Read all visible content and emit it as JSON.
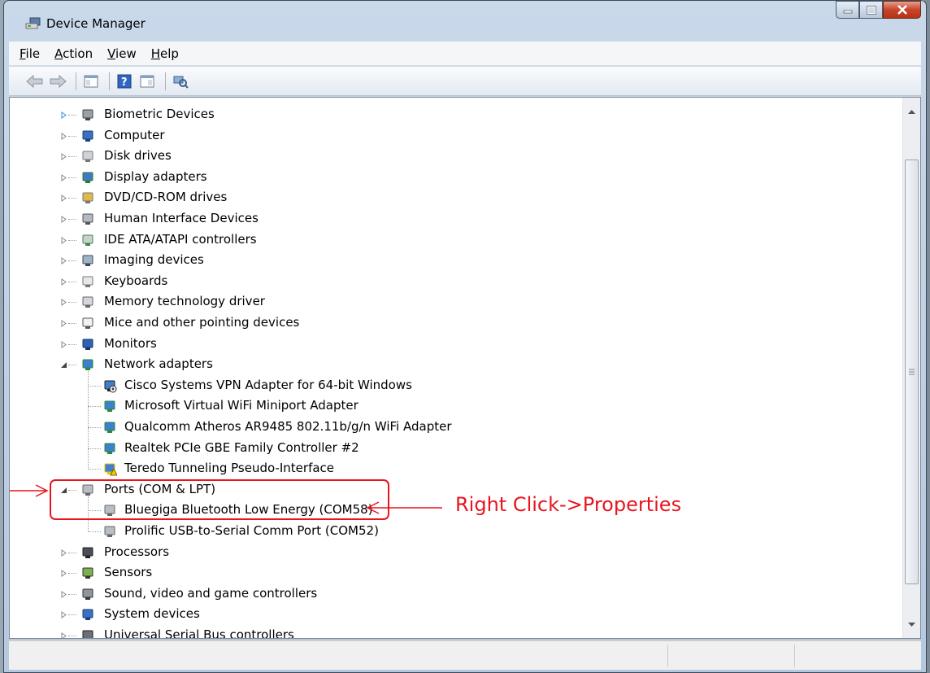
{
  "window": {
    "title": "Device Manager"
  },
  "menu": [
    {
      "label_pre": "",
      "label_ul": "F",
      "label_post": "ile"
    },
    {
      "label_pre": "",
      "label_ul": "A",
      "label_post": "ction"
    },
    {
      "label_pre": "",
      "label_ul": "V",
      "label_post": "iew"
    },
    {
      "label_pre": "",
      "label_ul": "H",
      "label_post": "elp"
    }
  ],
  "toolbar": [
    {
      "icon": "back-arrow-icon"
    },
    {
      "icon": "forward-arrow-icon"
    },
    {
      "icon": "show-hide-tree-icon"
    },
    {
      "icon": "help-icon"
    },
    {
      "icon": "properties-icon"
    },
    {
      "icon": "scan-hardware-icon"
    }
  ],
  "tree": [
    {
      "label": "Biometric Devices",
      "icon": "fingerprint-icon",
      "expanded": false,
      "level": 1
    },
    {
      "label": "Computer",
      "icon": "computer-icon",
      "expanded": false,
      "level": 1
    },
    {
      "label": "Disk drives",
      "icon": "disk-drive-icon",
      "expanded": false,
      "level": 1
    },
    {
      "label": "Display adapters",
      "icon": "display-adapter-icon",
      "expanded": false,
      "level": 1
    },
    {
      "label": "DVD/CD-ROM drives",
      "icon": "dvd-drive-icon",
      "expanded": false,
      "level": 1
    },
    {
      "label": "Human Interface Devices",
      "icon": "hid-icon",
      "expanded": false,
      "level": 1
    },
    {
      "label": "IDE ATA/ATAPI controllers",
      "icon": "ide-controller-icon",
      "expanded": false,
      "level": 1
    },
    {
      "label": "Imaging devices",
      "icon": "imaging-device-icon",
      "expanded": false,
      "level": 1
    },
    {
      "label": "Keyboards",
      "icon": "keyboard-icon",
      "expanded": false,
      "level": 1
    },
    {
      "label": "Memory technology driver",
      "icon": "memory-icon",
      "expanded": false,
      "level": 1
    },
    {
      "label": "Mice and other pointing devices",
      "icon": "mouse-icon",
      "expanded": false,
      "level": 1
    },
    {
      "label": "Monitors",
      "icon": "monitor-icon",
      "expanded": false,
      "level": 1
    },
    {
      "label": "Network adapters",
      "icon": "network-adapter-icon",
      "expanded": true,
      "level": 1
    },
    {
      "label": "Cisco Systems VPN Adapter for 64-bit Windows",
      "icon": "network-adapter-disabled-icon",
      "level": 2
    },
    {
      "label": "Microsoft Virtual WiFi Miniport Adapter",
      "icon": "network-adapter-icon",
      "level": 2
    },
    {
      "label": "Qualcomm Atheros AR9485 802.11b/g/n WiFi Adapter",
      "icon": "network-adapter-icon",
      "level": 2
    },
    {
      "label": "Realtek PCIe GBE Family Controller #2",
      "icon": "network-adapter-icon",
      "level": 2
    },
    {
      "label": "Teredo Tunneling Pseudo-Interface",
      "icon": "network-adapter-warning-icon",
      "level": 2
    },
    {
      "label": "Ports (COM & LPT)",
      "icon": "port-icon",
      "expanded": true,
      "level": 1
    },
    {
      "label": "Bluegiga Bluetooth Low Energy (COM58)",
      "icon": "port-icon",
      "level": 2
    },
    {
      "label": "Prolific USB-to-Serial Comm Port (COM52)",
      "icon": "port-icon",
      "level": 2
    },
    {
      "label": "Processors",
      "icon": "processor-icon",
      "expanded": false,
      "level": 1
    },
    {
      "label": "Sensors",
      "icon": "sensor-icon",
      "expanded": false,
      "level": 1
    },
    {
      "label": "Sound, video and game controllers",
      "icon": "speaker-icon",
      "expanded": false,
      "level": 1
    },
    {
      "label": "System devices",
      "icon": "system-device-icon",
      "expanded": false,
      "level": 1
    },
    {
      "label": "Universal Serial Bus controllers",
      "icon": "usb-icon",
      "expanded": false,
      "level": 1
    }
  ],
  "annotation": {
    "callout_text": "Right Click->Properties",
    "color": "#e8151f"
  },
  "colors": {
    "titlebar": "#c9d9ea",
    "close_button": "#c7432a",
    "tree_background": "#ffffff"
  }
}
